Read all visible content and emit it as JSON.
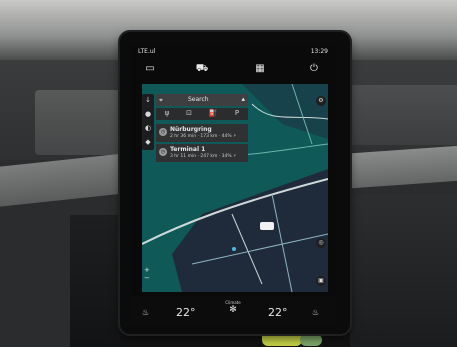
{
  "status_bar": {
    "network": "LTE.ul",
    "time": "13:29"
  },
  "top_nav": {
    "items": [
      {
        "icon": "camera-icon"
      },
      {
        "icon": "car-icon"
      },
      {
        "icon": "apps-grid-icon"
      },
      {
        "icon": "power-icon"
      }
    ]
  },
  "map_panel": {
    "search_label": "Search",
    "quick_icons": [
      "fork-icon",
      "cart-icon",
      "fuel-icon",
      "parking-icon"
    ],
    "destinations": [
      {
        "name": "Nürburgring",
        "info": "2 hr 36 min · 173 km · 44% ⚡"
      },
      {
        "name": "Terminal 1",
        "info": "3 hr 11 min · 247 km · 34% ⚡"
      }
    ]
  },
  "climate": {
    "left_temp": "22°",
    "right_temp": "22°",
    "fan_label": "Climate"
  },
  "colors": {
    "map_water": "#0f5a58",
    "map_land": "#1f2b3a",
    "road": "#cfd8d8",
    "screen_bg": "#0a0a0b"
  }
}
